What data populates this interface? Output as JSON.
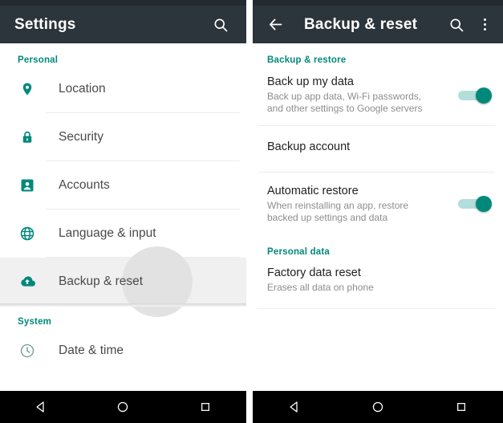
{
  "left_panel": {
    "appbar": {
      "title": "Settings",
      "search_icon": "search-icon"
    },
    "sections": [
      {
        "header": "Personal",
        "items": [
          {
            "label": "Location",
            "icon": "location-pin-icon",
            "selected": false
          },
          {
            "label": "Security",
            "icon": "lock-icon",
            "selected": false
          },
          {
            "label": "Accounts",
            "icon": "account-card-icon",
            "selected": false
          },
          {
            "label": "Language & input",
            "icon": "globe-icon",
            "selected": false
          },
          {
            "label": "Backup & reset",
            "icon": "cloud-upload-icon",
            "selected": true
          }
        ]
      },
      {
        "header": "System",
        "items": [
          {
            "label": "Date & time",
            "icon": "clock-icon",
            "selected": false
          }
        ]
      }
    ]
  },
  "right_panel": {
    "appbar": {
      "title": "Backup & reset",
      "back_icon": "back-arrow-icon",
      "search_icon": "search-icon",
      "overflow_icon": "overflow-menu-icon"
    },
    "sections": [
      {
        "header": "Backup & restore",
        "items": [
          {
            "title": "Back up my data",
            "subtitle": "Back up app data, Wi-Fi passwords, and other settings to Google servers",
            "toggle": "on"
          },
          {
            "title": "Backup account",
            "subtitle": "",
            "toggle": "none"
          },
          {
            "title": "Automatic restore",
            "subtitle": "When reinstalling an app, restore backed up settings and data",
            "toggle": "on"
          }
        ]
      },
      {
        "header": "Personal data",
        "items": [
          {
            "title": "Factory data reset",
            "subtitle": "Erases all data on phone",
            "toggle": "none"
          }
        ]
      }
    ]
  },
  "navbar": {
    "back_label": "back-button",
    "home_label": "home-button",
    "recents_label": "recents-button"
  },
  "colors": {
    "accent_teal": "#00897b",
    "appbar_dark": "#2c353b",
    "navbar_black": "#000000",
    "selected_row": "#f0f0f0"
  }
}
